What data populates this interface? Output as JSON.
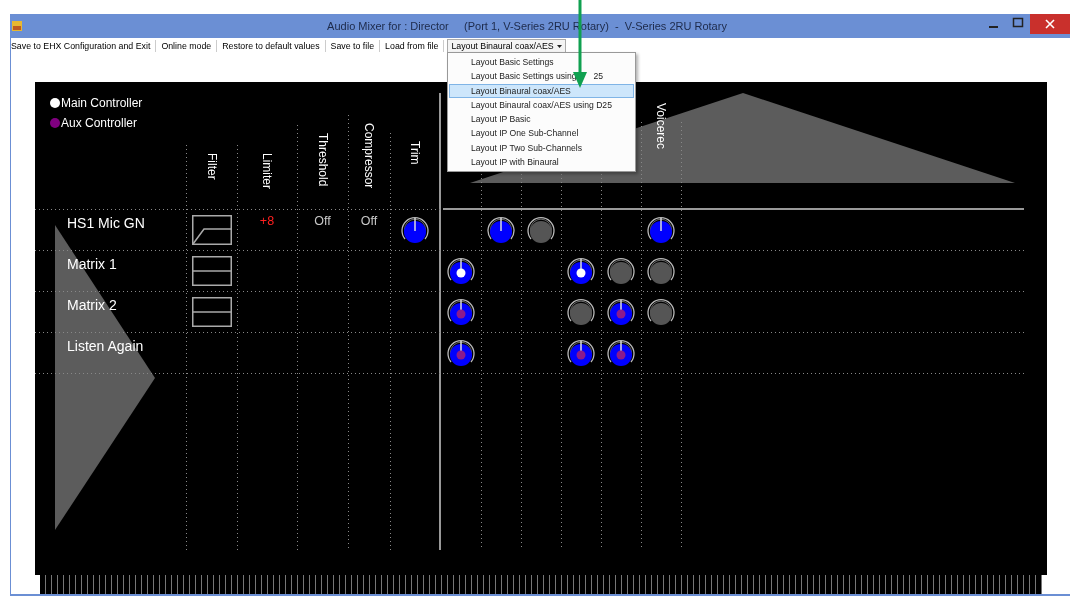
{
  "window": {
    "title": "Audio Mixer for : Director     (Port 1, V-Series 2RU Rotary)  -  V-Series 2RU Rotary"
  },
  "menu": [
    {
      "label": "Save to EHX Configuration and Exit"
    },
    {
      "label": "Online mode"
    },
    {
      "label": "Restore to default values"
    },
    {
      "label": "Save to file"
    },
    {
      "label": "Load from file"
    }
  ],
  "layout_dropdown": {
    "value": "Layout Binaural coax/AES",
    "expanded": true
  },
  "dropdown_menu": [
    {
      "label": "Layout Basic Settings",
      "selected": false
    },
    {
      "label": "Layout Basic Settings using",
      "label_after_arrow": "25",
      "selected": false
    },
    {
      "label": "Layout Binaural coax/AES",
      "selected": true
    },
    {
      "label": "Layout Binaural coax/AES using D25",
      "selected": false
    },
    {
      "label": "Layout IP Basic",
      "selected": false
    },
    {
      "label": "Layout IP One Sub-Channel",
      "selected": false
    },
    {
      "label": "Layout IP Two Sub-Channels",
      "selected": false
    },
    {
      "label": "Layout IP with Binaural",
      "selected": false
    }
  ],
  "legend": [
    {
      "label": "Main Controller",
      "color": "#ffffff"
    },
    {
      "label": "Aux Controller",
      "color": "#800080"
    }
  ],
  "columns": [
    "Filter",
    "Limiter",
    "Threshold",
    "Compressor",
    "Trim"
  ],
  "column_12": {
    "label": "Voicerec"
  },
  "rows": [
    {
      "name": "HS1 Mic GN",
      "filter": {
        "kind": "highpass"
      },
      "limiter": "+8",
      "threshold": "Off",
      "compressor": "Off",
      "trim": {
        "kind": "active"
      },
      "knobs": [
        {
          "kind": "blank"
        },
        {
          "kind": "active"
        },
        {
          "kind": "inactive"
        },
        {
          "kind": "blank"
        },
        {
          "kind": "blank"
        },
        {
          "kind": "active"
        }
      ]
    },
    {
      "name": "Matrix 1",
      "filter": {
        "kind": "flat"
      },
      "knobs": [
        {
          "kind": "active-main"
        },
        {
          "kind": "blank"
        },
        {
          "kind": "blank"
        },
        {
          "kind": "active-main"
        },
        {
          "kind": "inactive"
        },
        {
          "kind": "inactive"
        }
      ]
    },
    {
      "name": "Matrix 2",
      "filter": {
        "kind": "flat"
      },
      "knobs": [
        {
          "kind": "active-aux"
        },
        {
          "kind": "blank"
        },
        {
          "kind": "blank"
        },
        {
          "kind": "inactive"
        },
        {
          "kind": "active-aux"
        },
        {
          "kind": "inactive"
        }
      ]
    },
    {
      "name": "Listen Again",
      "knobs": [
        {
          "kind": "active-aux"
        },
        {
          "kind": "blank"
        },
        {
          "kind": "blank"
        },
        {
          "kind": "active-aux"
        },
        {
          "kind": "active-aux"
        },
        {
          "kind": "blank"
        }
      ]
    }
  ]
}
